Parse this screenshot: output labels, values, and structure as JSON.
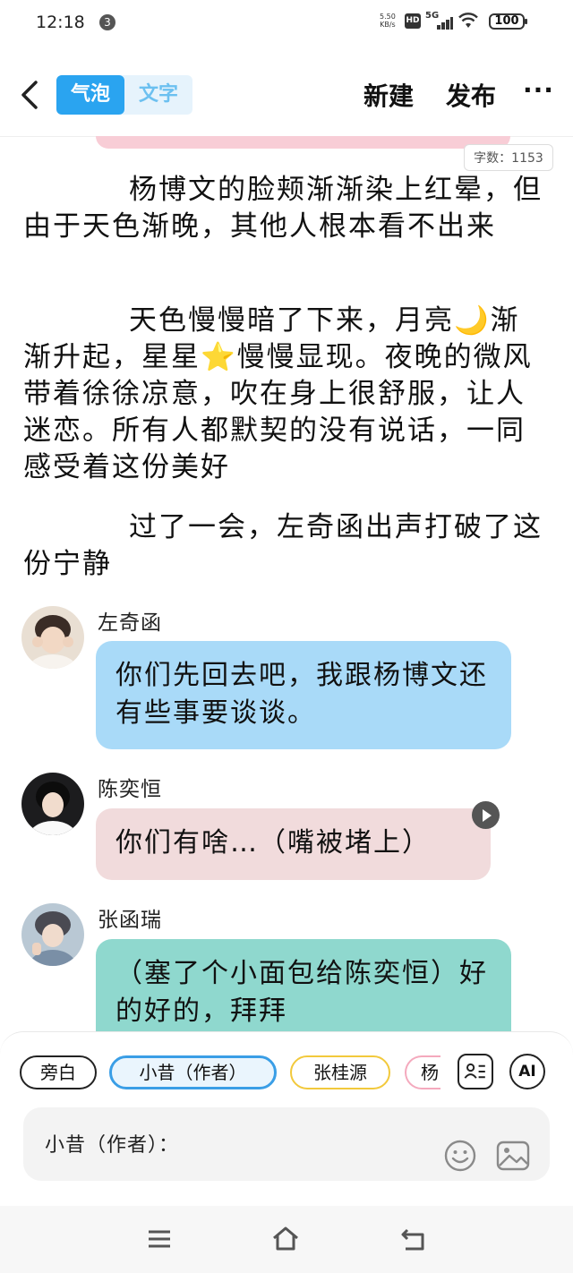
{
  "status_bar": {
    "time": "12:18",
    "notification_count": "3",
    "net_speed_value": "5.50",
    "net_speed_unit": "KB/s",
    "hd_label": "HD",
    "network_label": "5G",
    "battery": "100"
  },
  "header": {
    "tab_active": "气泡",
    "tab_inactive": "文字",
    "new_label": "新建",
    "publish_label": "发布",
    "more_label": "···"
  },
  "word_count": "字数：1153",
  "story": {
    "paragraphs": [
      "杨博文的脸颊渐渐染上红晕，但由于天色渐晚，其他人根本看不出来",
      "天色慢慢暗了下来，月亮🌙渐渐升起，星星⭐慢慢显现。夜晚的微风带着徐徐凉意，吹在身上很舒服，让人迷恋。所有人都默契的没有说话，一同感受着这份美好",
      "过了一会，左奇函出声打破了这份宁静"
    ]
  },
  "chat": {
    "messages": [
      {
        "speaker": "左奇函",
        "text": "你们先回去吧，我跟杨博文还有些事要谈谈。",
        "color": "#a9daf8"
      },
      {
        "speaker": "陈奕恒",
        "text": "你们有啥…（嘴被堵上）",
        "color": "#f1dbdc"
      },
      {
        "speaker": "张函瑞",
        "text": "（塞了个小面包给陈奕恒）好的好的，拜拜",
        "color": "#8fd8ce"
      }
    ]
  },
  "roles": {
    "chips": [
      "旁白",
      "小昔（作者）",
      "张桂源",
      "杨"
    ],
    "chip_colors": [
      "#222222",
      "#3a9ee6",
      "#f2c93c",
      "#f4a9bd"
    ]
  },
  "input": {
    "label": "小昔（作者）："
  },
  "icons": {
    "ai_label": "AI",
    "role_manage": "contact-card-icon",
    "emoji": "smiley-icon",
    "image": "image-icon"
  }
}
